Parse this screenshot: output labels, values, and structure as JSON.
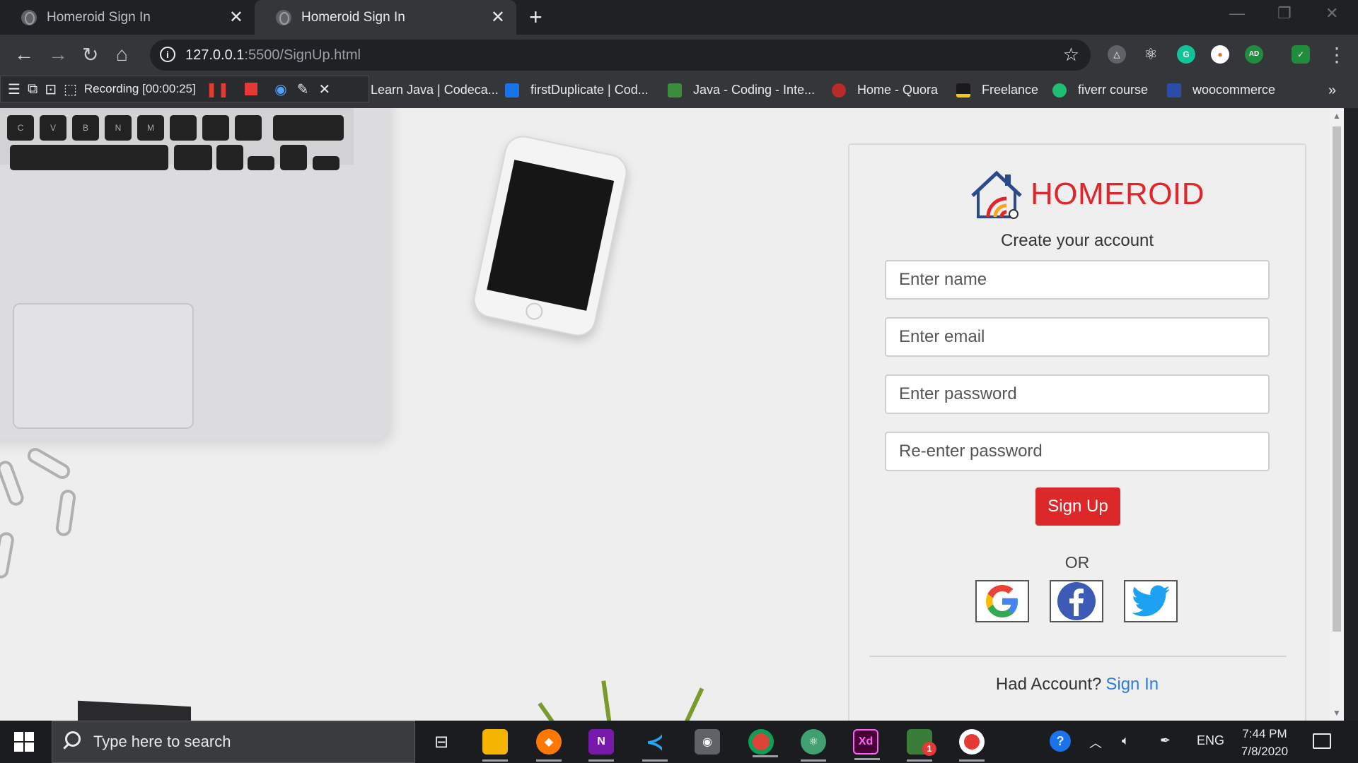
{
  "browser": {
    "tabs": [
      {
        "title": "Homeroid Sign In",
        "active": false
      },
      {
        "title": "Homeroid Sign In",
        "active": true
      }
    ],
    "url_host": "127.0.0.1",
    "url_rest": ":5500/SignUp.html",
    "recording_label": "Recording [00:00:25]",
    "bookmarks": [
      {
        "label": "Learn Java | Codeca...",
        "icon": "codecademy-icon",
        "color": "#35363a"
      },
      {
        "label": "firstDuplicate | Cod...",
        "icon": "codesignal-icon",
        "color": "#1a73e8"
      },
      {
        "label": "Java - Coding - Inte...",
        "icon": "interview-icon",
        "color": "#3c8c3c"
      },
      {
        "label": "Home - Quora",
        "icon": "quora-icon",
        "color": "#b92b27"
      },
      {
        "label": "Freelance",
        "icon": "freelancer-icon",
        "color": "#1a1a1a"
      },
      {
        "label": "fiverr course",
        "icon": "fiverr-icon",
        "color": "#1dbf73"
      },
      {
        "label": "woocommerce",
        "icon": "woocommerce-icon",
        "color": "#2b4ca8"
      }
    ],
    "bookmarks_overflow": "»"
  },
  "page": {
    "brand": {
      "name": "HOMEROID",
      "color": "#e0262b"
    },
    "subtitle": "Create your account",
    "fields": {
      "name_placeholder": "Enter name",
      "email_placeholder": "Enter email",
      "password_placeholder": "Enter password",
      "repassword_placeholder": "Re-enter password"
    },
    "signup_label": "Sign Up",
    "or_label": "OR",
    "social": [
      "google-icon",
      "facebook-icon",
      "twitter-icon"
    ],
    "had_account": "Had Account?",
    "sign_in_link": "Sign In"
  },
  "laptop_keys": [
    "C",
    "V",
    "B",
    "N",
    "M"
  ],
  "taskbar": {
    "search_placeholder": "Type here to search",
    "apps": [
      "task-view-icon",
      "file-explorer-icon",
      "avast-icon",
      "onenote-icon",
      "vscode-icon",
      "camera-icon",
      "chrome-icon",
      "atom-icon",
      "adobe-xd-icon",
      "whatsapp-icon",
      "recorder-icon"
    ],
    "whatsapp_badge": "1",
    "language": "ENG",
    "time": "7:44 PM",
    "date": "7/8/2020"
  }
}
